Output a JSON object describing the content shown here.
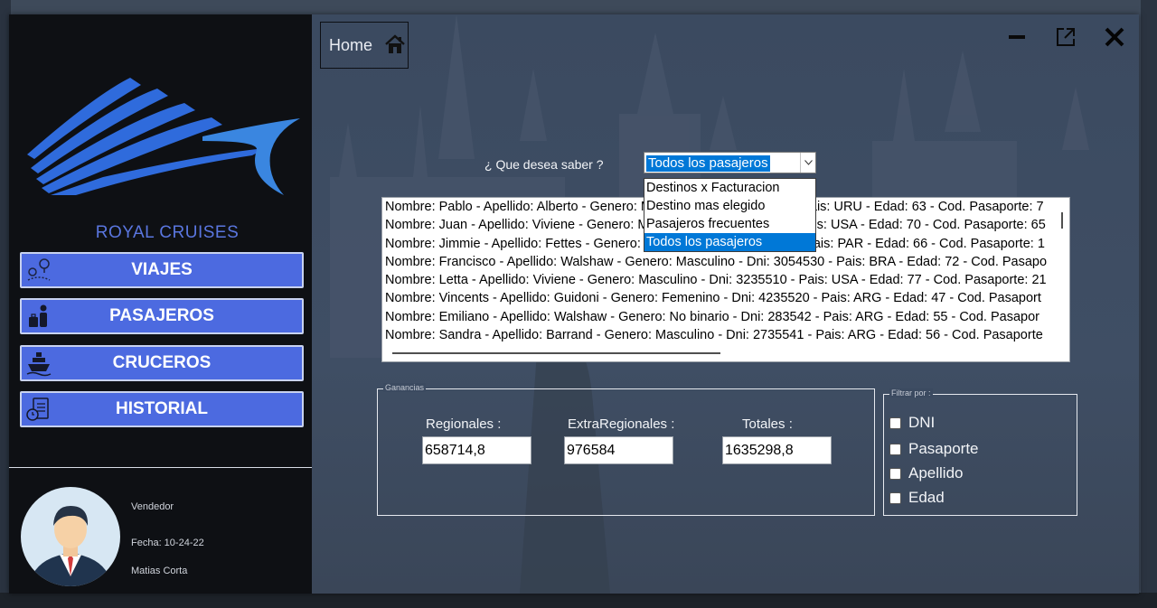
{
  "app": {
    "brand": "ROYAL CRUISES",
    "accent_color": "#4c6ae0",
    "sidebar_color": "#0e1014"
  },
  "sidebar": {
    "items": [
      {
        "label": "VIAJES",
        "icon": "map-pin-route-icon"
      },
      {
        "label": "PASAJEROS",
        "icon": "passenger-luggage-icon"
      },
      {
        "label": "CRUCEROS",
        "icon": "ship-icon"
      },
      {
        "label": "HISTORIAL",
        "icon": "document-history-icon"
      }
    ],
    "user": {
      "role": "Vendedor",
      "date": "Fecha: 10-24-22",
      "name": "Matias Corta"
    }
  },
  "header": {
    "home_label": "Home",
    "home_icon": "house-icon",
    "controls": [
      "minimize-icon",
      "maximize-icon",
      "close-icon"
    ]
  },
  "query": {
    "question": "¿ Que desea saber ?",
    "selected": "Todos los pasajeros",
    "options": [
      "Destinos x Facturacion",
      "Destino mas elegido",
      "Pasajeros frecuentes",
      "Todos los pasajeros"
    ]
  },
  "results": [
    "Nombre: Pablo - Apellido: Alberto - Genero: Masculino - Dni: 3154120 - Pais: URU  - Edad: 63 - Cod. Pasaporte: 7",
    "Nombre: Juan - Apellido: Viviene - Genero: Masculino - Dni: 3324510 - Pais: USA  - Edad: 70 - Cod. Pasaporte: 65",
    "Nombre: Jimmie - Apellido: Fettes - Genero: Masculino - Dni: 2714450 - Pais: PAR  - Edad: 66 - Cod. Pasaporte: 1",
    "Nombre: Francisco - Apellido: Walshaw - Genero: Masculino - Dni: 3054530 - Pais: BRA  - Edad: 72 - Cod. Pasapo",
    "Nombre: Letta - Apellido: Viviene - Genero: Masculino - Dni: 3235510 - Pais: USA  - Edad: 77 - Cod. Pasaporte: 21",
    "Nombre: Vincents - Apellido: Guidoni - Genero: Femenino - Dni: 4235520 - Pais: ARG  - Edad: 47 - Cod. Pasaport",
    "Nombre: Emiliano - Apellido: Walshaw - Genero: No binario - Dni: 283542 - Pais: ARG  - Edad: 55 - Cod. Pasapor",
    "Nombre: Sandra - Apellido: Barrand - Genero: Masculino - Dni: 2735541 - Pais: ARG  - Edad: 56 - Cod. Pasaporte"
  ],
  "ganancias": {
    "legend": "Ganancias",
    "regionales_label": "Regionales :",
    "regionales_value": "658714,8",
    "extra_label": "ExtraRegionales :",
    "extra_value": "976584",
    "totales_label": "Totales :",
    "totales_value": "1635298,8"
  },
  "filtro": {
    "legend": "Filtrar por :",
    "options": [
      "DNI",
      "Pasaporte",
      "Apellido",
      "Edad"
    ]
  }
}
